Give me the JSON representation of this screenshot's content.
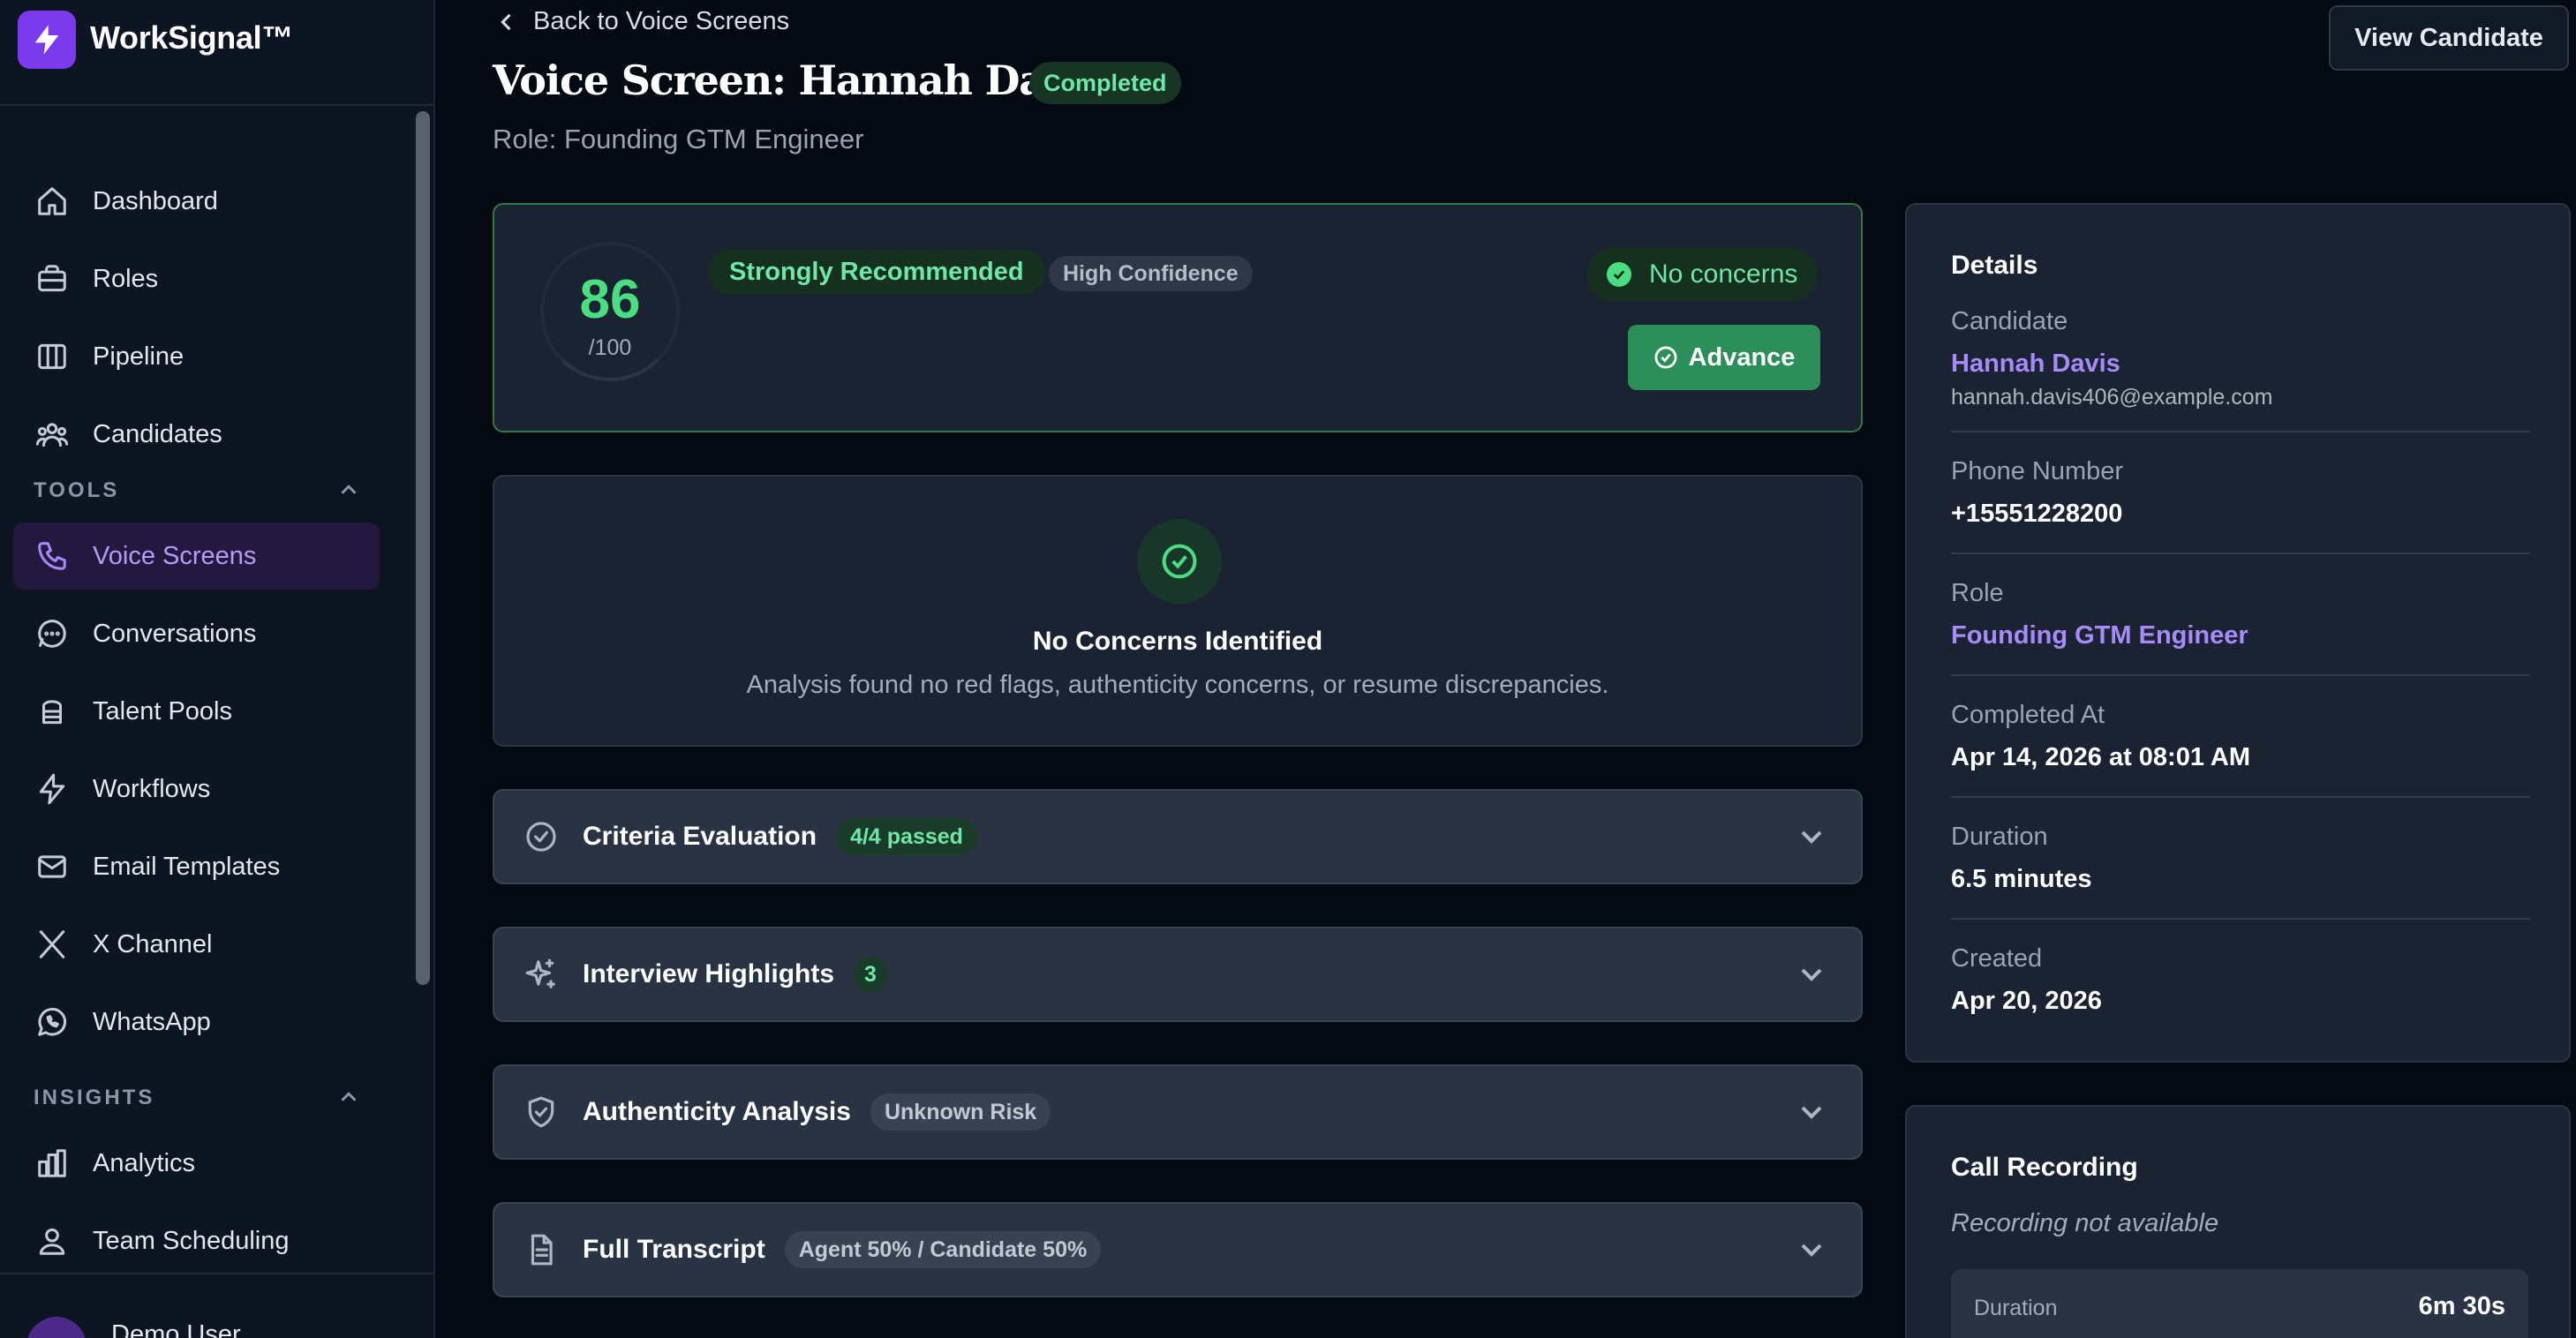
{
  "brand": {
    "name": "WorkSignal™"
  },
  "nav": {
    "main": [
      {
        "label": "Dashboard",
        "icon": "home-icon"
      },
      {
        "label": "Roles",
        "icon": "briefcase-icon"
      },
      {
        "label": "Pipeline",
        "icon": "columns-icon"
      },
      {
        "label": "Candidates",
        "icon": "users-icon"
      }
    ],
    "tools_label": "TOOLS",
    "tools": [
      {
        "label": "Voice Screens",
        "icon": "phone-icon",
        "active": true
      },
      {
        "label": "Conversations",
        "icon": "message-circle-icon"
      },
      {
        "label": "Talent Pools",
        "icon": "database-icon"
      },
      {
        "label": "Workflows",
        "icon": "zap-icon"
      },
      {
        "label": "Email Templates",
        "icon": "mail-icon"
      },
      {
        "label": "X Channel",
        "icon": "x-logo-icon"
      },
      {
        "label": "WhatsApp",
        "icon": "whatsapp-icon"
      }
    ],
    "insights_label": "INSIGHTS",
    "insights": [
      {
        "label": "Analytics",
        "icon": "bar-chart-icon"
      },
      {
        "label": "Team Scheduling",
        "icon": "user-group-icon"
      }
    ]
  },
  "user": {
    "name": "Demo User"
  },
  "header": {
    "back_label": "Back to Voice Screens",
    "title": "Voice Screen: Hannah Davis",
    "status": "Completed",
    "role_line": "Role: Founding GTM Engineer",
    "view_candidate_label": "View Candidate"
  },
  "score": {
    "value": "86",
    "out_of": "/100",
    "recommendation": "Strongly Recommended",
    "confidence": "High Confidence",
    "concerns_badge": "No concerns",
    "advance_label": "Advance"
  },
  "concerns": {
    "title": "No Concerns Identified",
    "description": "Analysis found no red flags, authenticity concerns, or resume discrepancies."
  },
  "sections": [
    {
      "title": "Criteria Evaluation",
      "tag": "4/4 passed",
      "icon": "check-circle-icon"
    },
    {
      "title": "Interview Highlights",
      "tag": "3",
      "icon": "sparkles-icon"
    },
    {
      "title": "Authenticity Analysis",
      "tag": "Unknown Risk",
      "icon": "shield-check-icon"
    },
    {
      "title": "Full Transcript",
      "tag": "Agent 50% / Candidate 50%",
      "icon": "file-text-icon"
    }
  ],
  "details": {
    "heading": "Details",
    "candidate_label": "Candidate",
    "candidate_name": "Hannah Davis",
    "candidate_email": "hannah.davis406@example.com",
    "phone_label": "Phone Number",
    "phone": "+15551228200",
    "role_label": "Role",
    "role": "Founding GTM Engineer",
    "completed_label": "Completed At",
    "completed": "Apr 14, 2026 at 08:01 AM",
    "duration_label": "Duration",
    "duration": "6.5 minutes",
    "created_label": "Created",
    "created": "Apr 20, 2026"
  },
  "recording": {
    "heading": "Call Recording",
    "status": "Recording not available",
    "duration_label": "Duration",
    "duration": "6m 30s"
  },
  "colors": {
    "accent_purple": "#a78bfa",
    "success_green": "#4ade80",
    "advance_button": "#2c8f5a",
    "background": "#050a12"
  }
}
